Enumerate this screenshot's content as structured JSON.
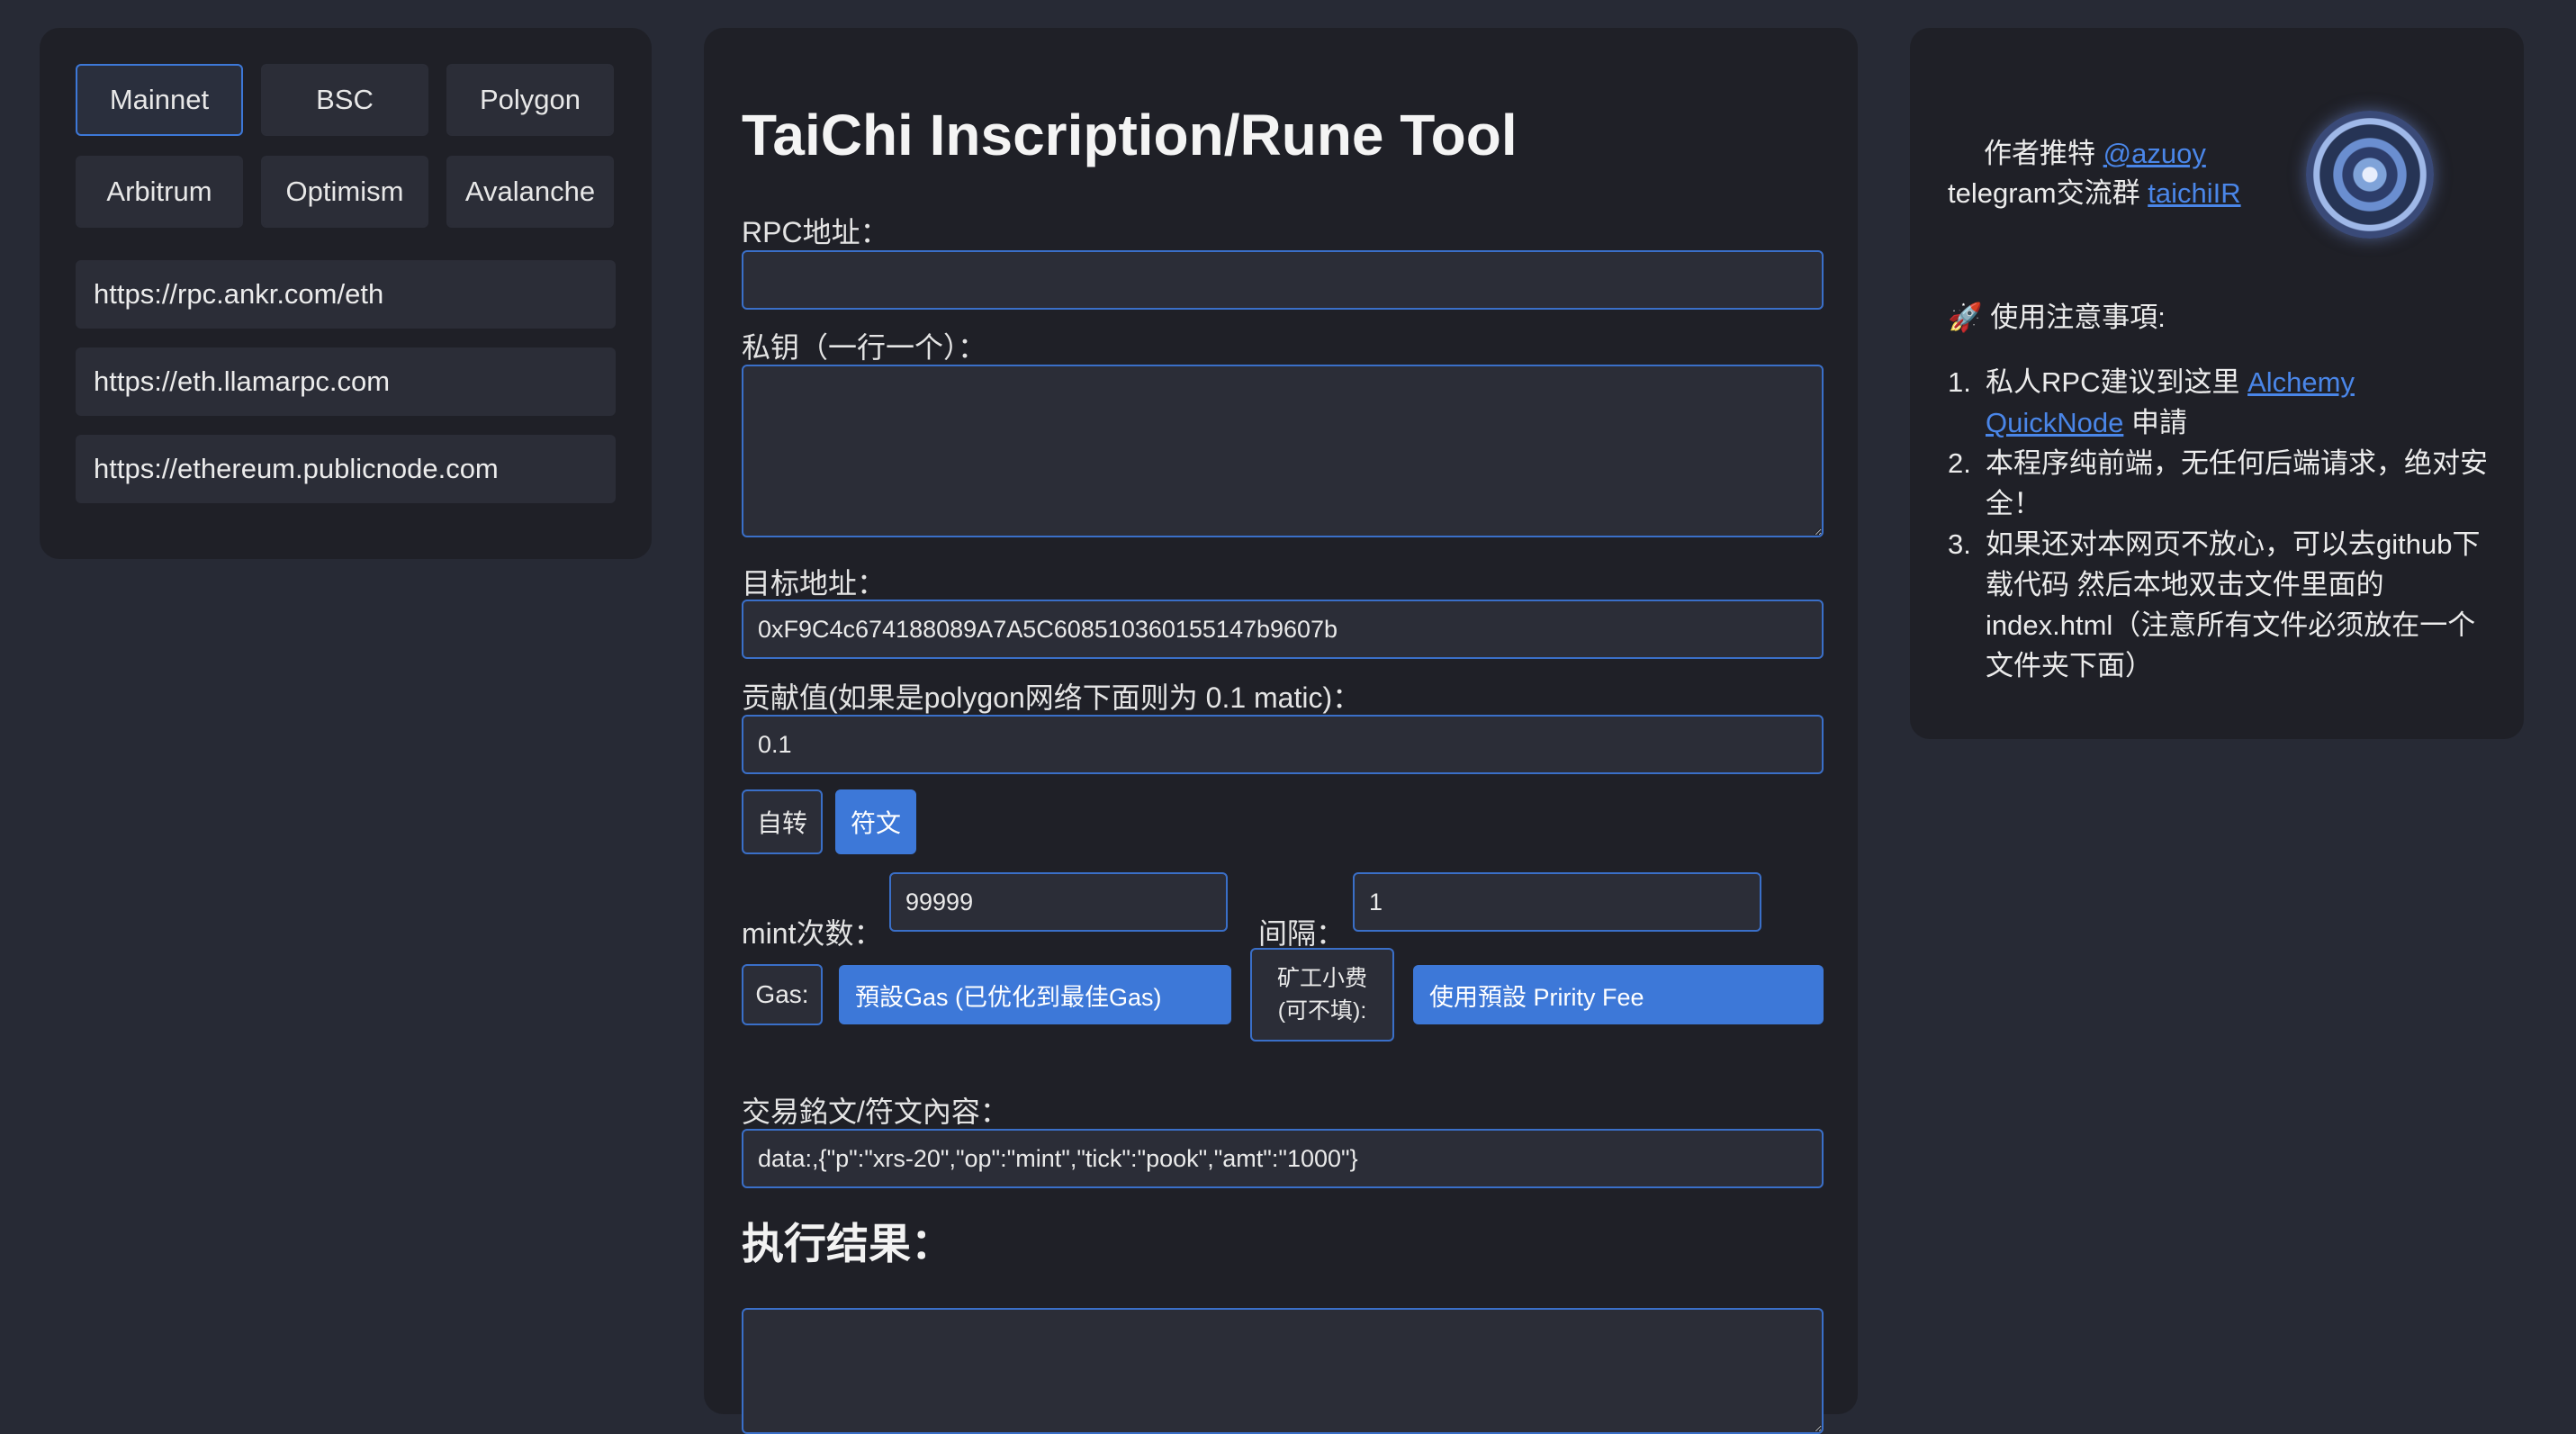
{
  "networks": [
    "Mainnet",
    "BSC",
    "Polygon",
    "Arbitrum",
    "Optimism",
    "Avalanche"
  ],
  "selected_network": "Mainnet",
  "rpc_list": [
    "https://rpc.ankr.com/eth",
    "https://eth.llamarpc.com",
    "https://ethereum.publicnode.com"
  ],
  "main": {
    "title": "TaiChi Inscription/Rune Tool",
    "rpc_label": "RPC地址：",
    "rpc_value": "",
    "private_key_label": "私钥（一行一个）：",
    "private_key_value": "",
    "target_label": "目标地址：",
    "target_value": "0xF9C4c674188089A7A5C608510360155147b9607b",
    "contribution_label": "贡献值(如果是polygon网络下面则为 0.1 matic)：",
    "contribution_value": "0.1",
    "mode_buttons": [
      "自转",
      "符文"
    ],
    "active_mode": "符文",
    "mint_count_label": "mint次数：",
    "mint_count_value": "99999",
    "interval_label": "间隔：",
    "interval_value": "1",
    "gas_label": "Gas:",
    "gas_select": "預設Gas (已优化到最佳Gas)",
    "priority_label_line1": "矿工小费",
    "priority_label_line2": "(可不填):",
    "priority_select": "使用預設 Pririty Fee",
    "inscription_label": "交易銘文/符文內容：",
    "inscription_value": "data:,{\"p\":\"xrs-20\",\"op\":\"mint\",\"tick\":\"pook\",\"amt\":\"1000\"}",
    "result_title": "执行结果："
  },
  "sidebar": {
    "author_label": "作者推特",
    "author_link": "@azuoy",
    "group_label": "telegram交流群",
    "group_link": "taichiIR",
    "notes_title": "🚀 使用注意事項:",
    "note1_text": "私人RPC建议到这里",
    "note1_link1": "Alchemy",
    "note1_link2": "QuickNode",
    "note1_suffix": "申請",
    "note2": "本程序纯前端，无任何后端请求，绝对安全！",
    "note3": "如果还对本网页不放心，可以去github下载代码 然后本地双击文件里面的index.html（注意所有文件必须放在一个文件夹下面）",
    "note_numbers": [
      "1.",
      "2.",
      "3."
    ]
  },
  "colors": {
    "accent": "#3d78d8",
    "panel": "#1f2027",
    "background": "#272a35",
    "link": "#4a86e8"
  },
  "icons": {
    "avatar": "author-avatar"
  }
}
